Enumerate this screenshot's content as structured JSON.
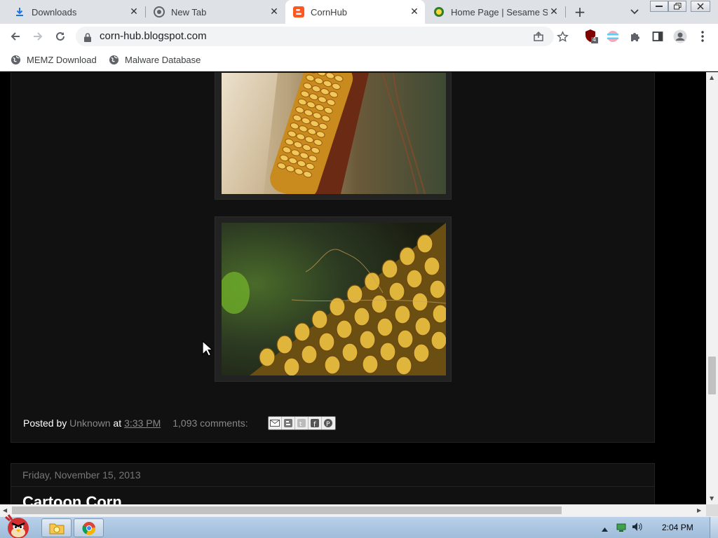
{
  "browser": {
    "tabs": [
      {
        "label": "Downloads",
        "icon": "download-icon",
        "active": false
      },
      {
        "label": "New Tab",
        "icon": "chrome-icon",
        "active": false
      },
      {
        "label": "CornHub",
        "icon": "blogger-icon",
        "active": true
      },
      {
        "label": "Home Page | Sesame St",
        "icon": "sesame-street-icon",
        "active": false
      }
    ],
    "url": "corn-hub.blogspot.com",
    "extension_badge": "4",
    "bookmarks": [
      {
        "label": "MEMZ Download",
        "icon": "globe-icon"
      },
      {
        "label": "Malware Database",
        "icon": "globe-icon"
      }
    ],
    "colors": {
      "tabstrip": "#dee1e6",
      "active_tab": "#ffffff",
      "blogger_orange": "#ff5722"
    }
  },
  "page": {
    "post_footer": {
      "posted_by_label": "Posted by",
      "author": "Unknown",
      "at_label": "at",
      "time": "3:33 PM",
      "comments": "1,093 comments:"
    },
    "share_buttons": [
      "email-icon",
      "blogger-icon",
      "twitter-icon",
      "facebook-icon",
      "pinterest-icon"
    ],
    "next_post": {
      "date_header": "Friday, November 15, 2013",
      "title": "Cartoon Corn"
    },
    "colors": {
      "background": "#000000",
      "post_bg": "#111111",
      "frame": "#222222",
      "muted_text": "#888888"
    }
  },
  "taskbar": {
    "apps": [
      "explorer-icon",
      "chrome-icon"
    ],
    "clock": "2:04 PM",
    "tray_icons": [
      "chevron-up-icon",
      "network-icon",
      "volume-icon"
    ]
  }
}
